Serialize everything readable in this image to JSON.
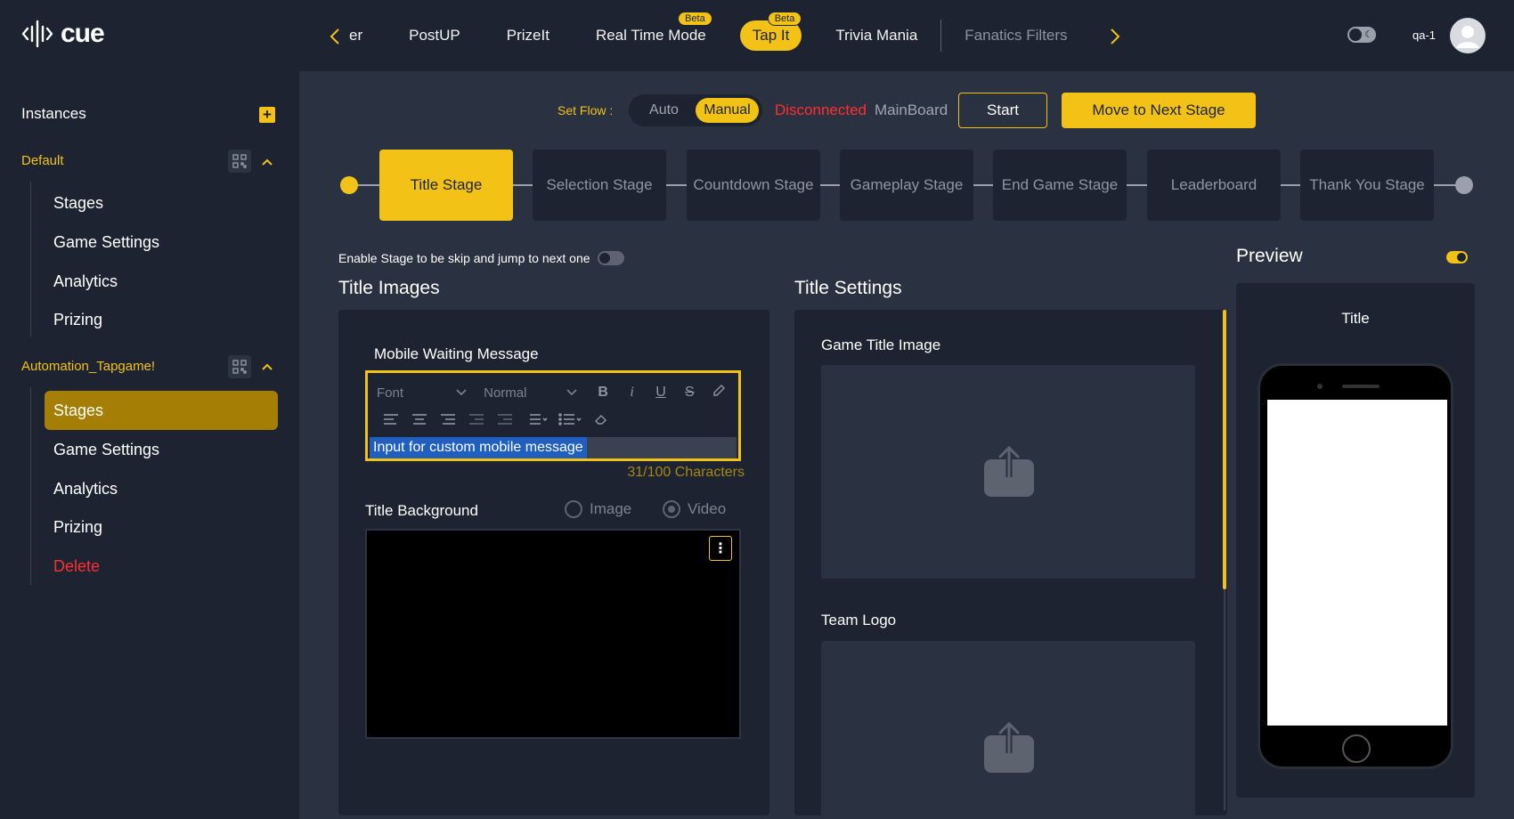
{
  "app": {
    "logo_text": "cue"
  },
  "top_nav": {
    "tabs": [
      {
        "label": "er"
      },
      {
        "label": "PostUP"
      },
      {
        "label": "PrizeIt"
      },
      {
        "label": "Real Time Mode",
        "badge": "Beta"
      },
      {
        "label": "Tap It",
        "badge": "Beta",
        "active": true
      },
      {
        "label": "Trivia Mania"
      },
      {
        "label": "Fanatics Filters",
        "dimmed": true
      }
    ],
    "username": "qa-1"
  },
  "sidebar": {
    "heading": "Instances",
    "groups": [
      {
        "name": "Default",
        "items": [
          {
            "label": "Stages"
          },
          {
            "label": "Game Settings"
          },
          {
            "label": "Analytics"
          },
          {
            "label": "Prizing"
          }
        ]
      },
      {
        "name": "Automation_Tapgame!",
        "items": [
          {
            "label": "Stages",
            "active": true
          },
          {
            "label": "Game Settings"
          },
          {
            "label": "Analytics"
          },
          {
            "label": "Prizing"
          },
          {
            "label": "Delete",
            "danger": true
          }
        ]
      }
    ]
  },
  "flow": {
    "set_flow_label": "Set Flow :",
    "options": [
      "Auto",
      "Manual"
    ],
    "selected": "Manual",
    "connection_status": "Disconnected",
    "board_name": "MainBoard",
    "start_label": "Start",
    "next_stage_label": "Move to Next Stage"
  },
  "stages": [
    {
      "label": "Title Stage",
      "active": true
    },
    {
      "label": "Selection Stage"
    },
    {
      "label": "Countdown Stage"
    },
    {
      "label": "Gameplay Stage"
    },
    {
      "label": "End Game Stage"
    },
    {
      "label": "Leaderboard"
    },
    {
      "label": "Thank You Stage"
    }
  ],
  "skip_toggle": {
    "label": "Enable Stage to be skip and jump to next one",
    "on": false
  },
  "title_images": {
    "heading": "Title Images",
    "mobile_waiting_message": {
      "label": "Mobile Waiting Message",
      "font_placeholder": "Font",
      "size_value": "Normal",
      "value": "Input for custom mobile message",
      "char_count": "31/100 Characters"
    },
    "title_background": {
      "label": "Title Background",
      "options": [
        "Image",
        "Video"
      ],
      "selected": "Video"
    }
  },
  "title_settings": {
    "heading": "Title Settings",
    "game_title_image_label": "Game Title Image",
    "team_logo_label": "Team Logo"
  },
  "preview": {
    "heading": "Preview",
    "enabled": true,
    "screen_title": "Title"
  },
  "colors": {
    "accent": "#f2c217",
    "danger": "#ff2f2f",
    "background": "#1d2330",
    "surface": "#2a3140"
  }
}
